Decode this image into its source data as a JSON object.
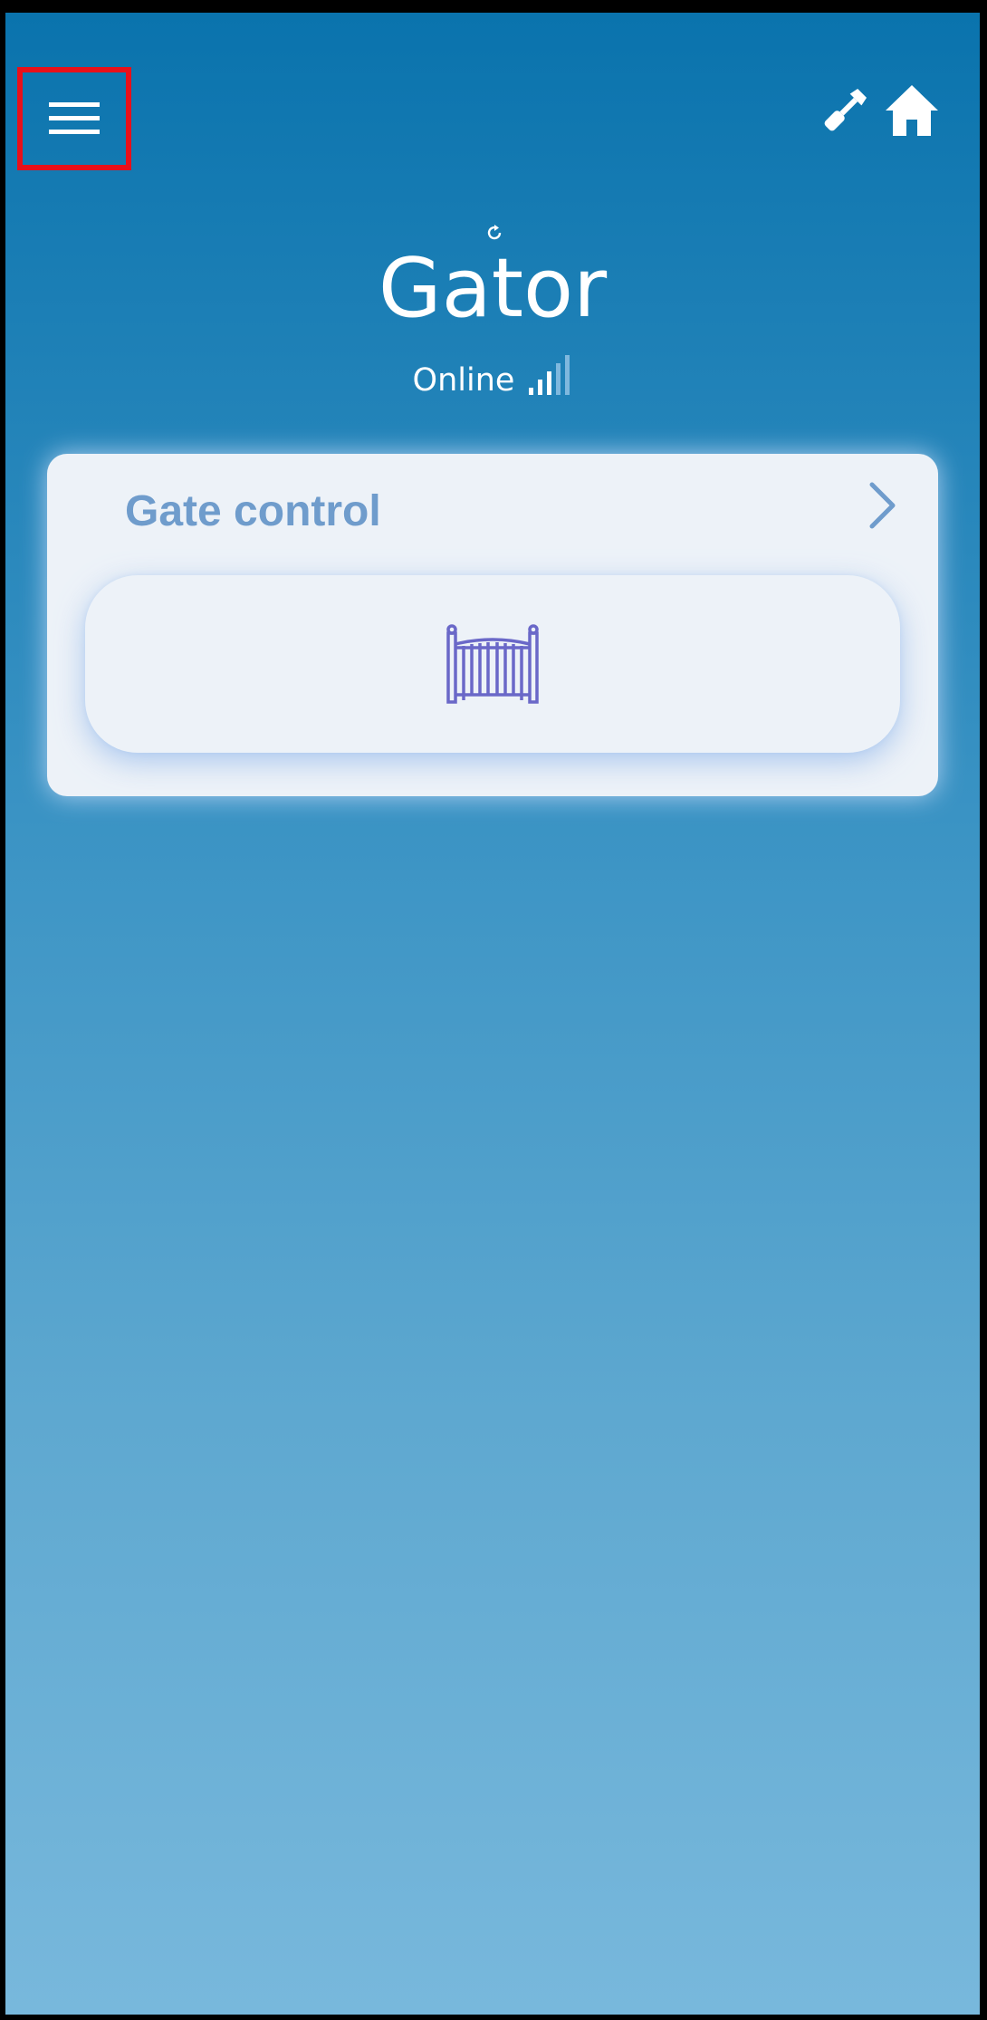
{
  "header": {
    "menu_icon": "hamburger-menu-icon",
    "tool_icon": "wrench-icon",
    "home_icon": "home-icon"
  },
  "device": {
    "name": "Gator",
    "status": "Online",
    "refresh_icon": "refresh-icon",
    "signal_icon": "signal-strength-icon",
    "signal_bars_active": 3,
    "signal_bars_total": 5
  },
  "card": {
    "title": "Gate control",
    "chevron_icon": "chevron-right-icon",
    "gate_icon": "gate-icon"
  },
  "colors": {
    "gradient_top": "#0a73ad",
    "gradient_bottom": "#78b8dc",
    "card_bg": "#edf2f8",
    "card_title": "#6f9ccc",
    "gate_icon": "#6a68c8",
    "highlight": "#e8101a"
  }
}
